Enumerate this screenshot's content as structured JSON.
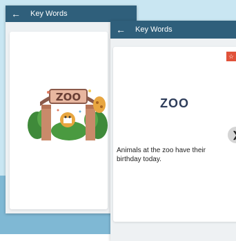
{
  "back_screen": {
    "header": {
      "title": "Key Words"
    }
  },
  "front_screen": {
    "header": {
      "title": "Key Words"
    },
    "card": {
      "word": "ZOO",
      "sentence": "Animals at the zoo have their birthday today."
    }
  },
  "illustration": {
    "sign_text": "ZOO"
  },
  "icons": {
    "back": "back-arrow-icon",
    "favorite": "star-icon",
    "next": "chevron-right-icon"
  },
  "colors": {
    "header_bg": "#2f5f7b",
    "title_text": "#2e3d5a",
    "badge": "#e0523a",
    "backdrop": "#c9e6f2"
  }
}
